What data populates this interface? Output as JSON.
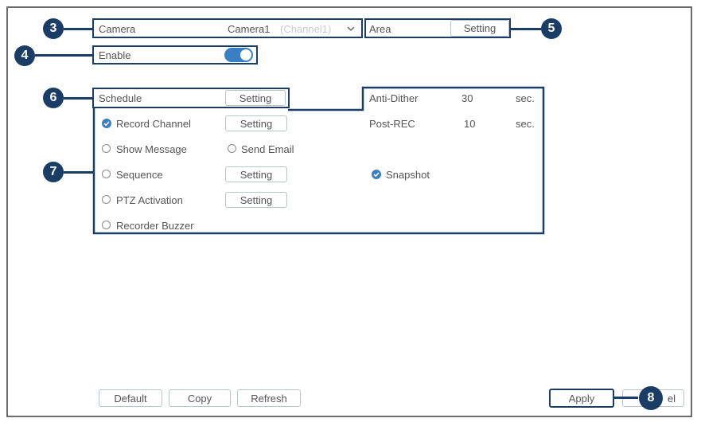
{
  "camera": {
    "label": "Camera",
    "value": "Camera1",
    "channel": "(Channel1)",
    "chevron_icon": "chevron-down-icon"
  },
  "area": {
    "label": "Area",
    "button": "Setting"
  },
  "enable": {
    "label": "Enable",
    "on": true
  },
  "schedule": {
    "label": "Schedule",
    "button": "Setting"
  },
  "anti_dither": {
    "label": "Anti-Dither",
    "value": "30",
    "unit": "sec."
  },
  "post_rec": {
    "label": "Post-REC",
    "value": "10",
    "unit": "sec."
  },
  "actions": {
    "record_channel": {
      "label": "Record Channel",
      "checked": true,
      "button": "Setting"
    },
    "show_message": {
      "label": "Show Message",
      "checked": false
    },
    "send_email": {
      "label": "Send Email",
      "checked": false
    },
    "sequence": {
      "label": "Sequence",
      "checked": false,
      "button": "Setting"
    },
    "snapshot": {
      "label": "Snapshot",
      "checked": true
    },
    "ptz_activation": {
      "label": "PTZ Activation",
      "checked": false,
      "button": "Setting"
    },
    "recorder_buzzer": {
      "label": "Recorder Buzzer",
      "checked": false
    }
  },
  "footer": {
    "default": "Default",
    "copy": "Copy",
    "refresh": "Refresh",
    "apply": "Apply",
    "cancel_partial": "el"
  },
  "callouts": [
    "3",
    "4",
    "5",
    "6",
    "7",
    "8"
  ],
  "colors": {
    "accent": "#3a7fc4",
    "callout": "#1a3d66"
  }
}
